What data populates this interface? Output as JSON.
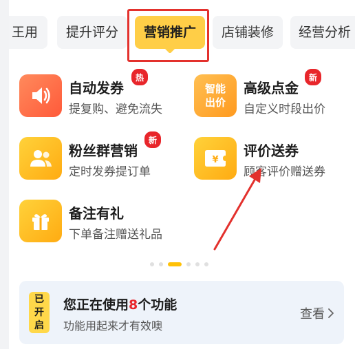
{
  "tabs": [
    {
      "label": "王用"
    },
    {
      "label": "提升评分"
    },
    {
      "label": "营销推广",
      "active": true
    },
    {
      "label": "店铺装修"
    },
    {
      "label": "经营分析"
    }
  ],
  "features": [
    {
      "title": "自动发券",
      "subtitle": "提复购、避免流失",
      "icon": "speaker-icon",
      "badge": "热"
    },
    {
      "title": "高级点金",
      "subtitle": "自定义时段出价",
      "icon_text": "智能出价",
      "badge": "新"
    },
    {
      "title": "粉丝群营销",
      "subtitle": "定时发券提订单",
      "icon": "group-icon",
      "badge": "新"
    },
    {
      "title": "评价送券",
      "subtitle": "顾客评价赠送券",
      "icon": "coupon-yen-icon"
    },
    {
      "title": "备注有礼",
      "subtitle": "下单备注赠送礼品",
      "icon": "gift-icon"
    }
  ],
  "pagination": {
    "count": 6,
    "active_index": 2
  },
  "status_card": {
    "tag": [
      "已",
      "开",
      "启"
    ],
    "title_prefix": "您正在使用",
    "title_count": "8",
    "title_suffix": "个功能",
    "subtitle": "功能用起来才有效噢",
    "view_label": "查看"
  },
  "colors": {
    "accent_yellow": "#ffce47",
    "highlight_red": "#e3312d",
    "badge_red": "#e8262b"
  }
}
